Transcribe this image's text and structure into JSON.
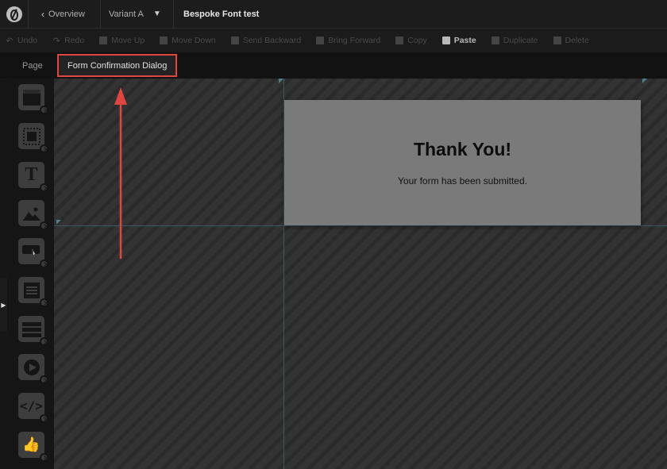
{
  "topbar": {
    "overview_label": "Overview",
    "variant_label": "Variant A",
    "project_name": "Bespoke Font test"
  },
  "toolbar": {
    "undo": "Undo",
    "redo": "Redo",
    "move_up": "Move Up",
    "move_down": "Move Down",
    "send_backward": "Send Backward",
    "bring_forward": "Bring Forward",
    "copy": "Copy",
    "paste": "Paste",
    "duplicate": "Duplicate",
    "delete": "Delete"
  },
  "tabs": {
    "page": "Page",
    "dialog": "Form Confirmation Dialog"
  },
  "sidebar": {
    "widgets": [
      "section",
      "box",
      "text",
      "image",
      "button",
      "form",
      "list",
      "video",
      "custom-html",
      "social"
    ]
  },
  "dialog": {
    "title": "Thank You!",
    "message": "Your form has been submitted."
  },
  "colors": {
    "highlight": "#e04640",
    "canvas": "#333333",
    "dialog_bg": "#7a7a7a"
  }
}
